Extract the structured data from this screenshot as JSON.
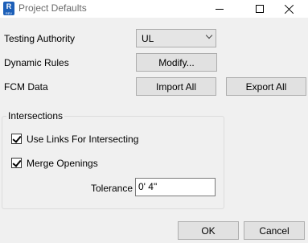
{
  "window": {
    "title": "Project Defaults",
    "icon_letter": "R",
    "icon_sub": "REV"
  },
  "form": {
    "testing_authority": {
      "label": "Testing Authority",
      "value": "UL"
    },
    "dynamic_rules": {
      "label": "Dynamic Rules",
      "button": "Modify..."
    },
    "fcm_data": {
      "label": "FCM Data",
      "import_button": "Import All",
      "export_button": "Export All"
    }
  },
  "intersections": {
    "title": "Intersections",
    "use_links": {
      "label": "Use Links For Intersecting",
      "checked": true
    },
    "merge_openings": {
      "label": "Merge Openings",
      "checked": true
    },
    "tolerance": {
      "label": "Tolerance",
      "value": "0'  4\""
    }
  },
  "buttons": {
    "ok": "OK",
    "cancel": "Cancel"
  },
  "colors": {
    "background": "#f0f0f0",
    "button": "#e1e1e1",
    "app_icon": "#1c5fb8"
  }
}
